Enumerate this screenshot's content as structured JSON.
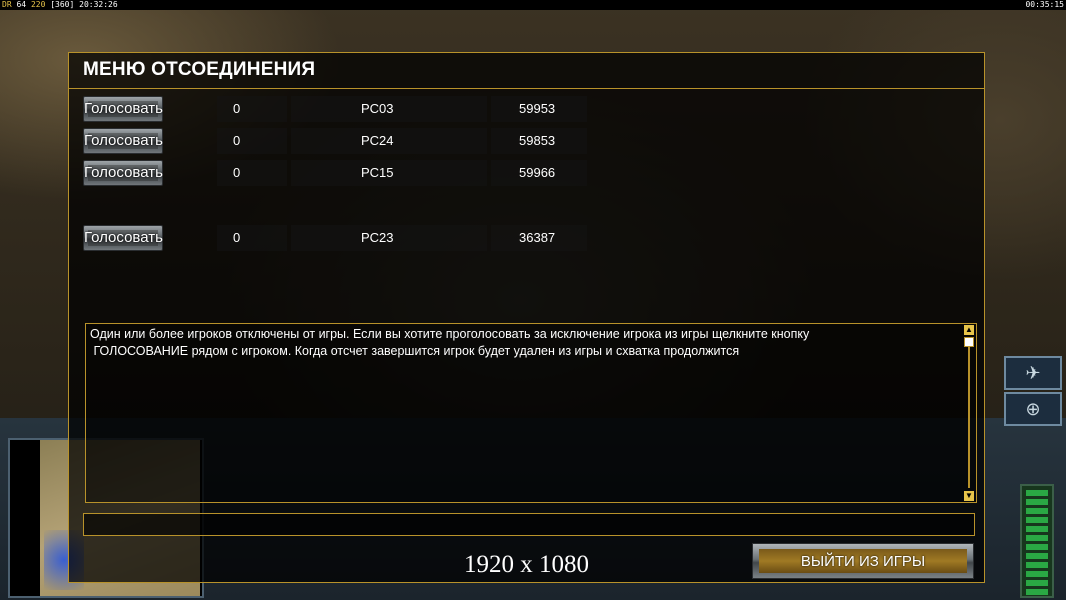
{
  "hud": {
    "top_left_label": "DR",
    "top_left_a": "64",
    "top_left_b": "220",
    "top_left_c": "[360]",
    "top_left_time": "20:32:26",
    "top_right_time": "00:35:15"
  },
  "dialog": {
    "title": "МЕНЮ ОТСОЕДИНЕНИЯ",
    "players": [
      {
        "vote_label": "Голосовать",
        "votes": "0",
        "name": "PC03",
        "ping": "59953"
      },
      {
        "vote_label": "Голосовать",
        "votes": "0",
        "name": "PC24",
        "ping": "59853"
      },
      {
        "vote_label": "Голосовать",
        "votes": "0",
        "name": "PC15",
        "ping": "59966"
      },
      {
        "vote_label": "Голосовать",
        "votes": "0",
        "name": "PC23",
        "ping": "36387"
      }
    ],
    "message_line1": "Один или более игроков отключены от игры. Если вы хотите проголосовать за исключение игрока из игры щелкните кнопку",
    "message_line2": " ГОЛОСОВАНИЕ рядом с игроком. Когда отсчет завершится игрок будет удален из игры и схватка продолжится",
    "chat_value": "",
    "quit_label": "ВЫЙТИ ИЗ ИГРЫ"
  },
  "overlay": {
    "resolution": "1920 x 1080"
  },
  "colors": {
    "accent": "#b8922a",
    "button_fill": "#a07a24"
  }
}
